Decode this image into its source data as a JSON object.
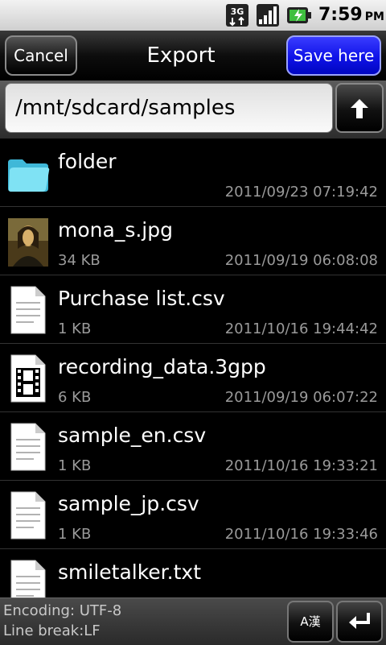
{
  "status_bar": {
    "network_type": "3G",
    "time": "7:59",
    "ampm": "PM",
    "icons": [
      "3g-data-icon",
      "signal-strength-icon",
      "battery-charging-icon"
    ]
  },
  "title_bar": {
    "cancel_label": "Cancel",
    "title": "Export",
    "save_label": "Save here"
  },
  "path_bar": {
    "path": "/mnt/sdcard/samples",
    "up_icon": "arrow-up-icon"
  },
  "files": [
    {
      "name": "folder",
      "size": "",
      "date": "2011/09/23 07:19:42",
      "icon": "folder-icon"
    },
    {
      "name": "mona_s.jpg",
      "size": "34 KB",
      "date": "2011/09/19 06:08:08",
      "icon": "image-thumbnail-icon"
    },
    {
      "name": "Purchase list.csv",
      "size": "1 KB",
      "date": "2011/10/16 19:44:42",
      "icon": "document-icon"
    },
    {
      "name": "recording_data.3gpp",
      "size": "6 KB",
      "date": "2011/09/19 06:07:22",
      "icon": "film-icon"
    },
    {
      "name": "sample_en.csv",
      "size": "1 KB",
      "date": "2011/10/16 19:33:21",
      "icon": "document-icon"
    },
    {
      "name": "sample_jp.csv",
      "size": "1 KB",
      "date": "2011/10/16 19:33:46",
      "icon": "document-icon"
    },
    {
      "name": "smiletalker.txt",
      "size": "",
      "date": "",
      "icon": "document-icon"
    }
  ],
  "bottom_bar": {
    "encoding": "Encoding:  UTF-8",
    "line_break": "Line break:LF",
    "ime_label": "A漢",
    "enter_icon": "enter-return-icon"
  },
  "colors": {
    "save_button": "#1a1df0",
    "folder": "#5fd0ea",
    "secondary_text": "#9a9a9a"
  }
}
